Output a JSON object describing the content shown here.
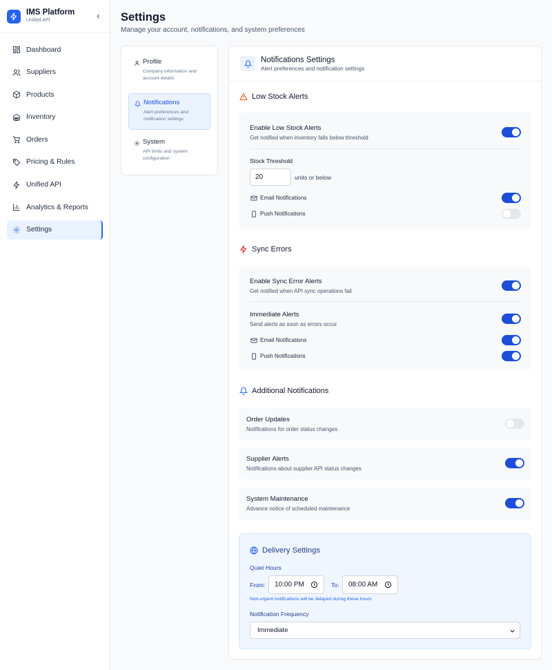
{
  "brand": {
    "title": "IMS Platform",
    "subtitle": "Unified API"
  },
  "sidebar": {
    "items": [
      {
        "label": "Dashboard",
        "icon": "dashboard-icon"
      },
      {
        "label": "Suppliers",
        "icon": "users-icon"
      },
      {
        "label": "Products",
        "icon": "package-icon"
      },
      {
        "label": "Inventory",
        "icon": "warehouse-icon"
      },
      {
        "label": "Orders",
        "icon": "cart-icon"
      },
      {
        "label": "Pricing & Rules",
        "icon": "tag-icon"
      },
      {
        "label": "Unified API",
        "icon": "bolt-icon"
      },
      {
        "label": "Analytics & Reports",
        "icon": "bar-chart-icon"
      },
      {
        "label": "Settings",
        "icon": "gear-icon",
        "active": true
      }
    ]
  },
  "header": {
    "title": "Settings",
    "subtitle": "Manage your account, notifications, and system preferences"
  },
  "subnav": {
    "items": [
      {
        "title": "Profile",
        "desc": "Company information and account details",
        "icon": "user-icon"
      },
      {
        "title": "Notifications",
        "desc": "Alert preferences and notification settings",
        "icon": "bell-icon",
        "active": true
      },
      {
        "title": "System",
        "desc": "API limits and system configuration",
        "icon": "gear-icon"
      }
    ]
  },
  "panel": {
    "title": "Notifications Settings",
    "subtitle": "Alert preferences and notification settings",
    "low_stock": {
      "section_title": "Low Stock Alerts",
      "enable_title": "Enable Low Stock Alerts",
      "enable_desc": "Get notified when inventory falls below threshold",
      "enable_on": true,
      "threshold_label": "Stock Threshold",
      "threshold_value": "20",
      "threshold_unit": "units or below",
      "email_label": "Email Notifications",
      "email_on": true,
      "push_label": "Push Notifications",
      "push_on": false
    },
    "sync_errors": {
      "section_title": "Sync Errors",
      "enable_title": "Enable Sync Error Alerts",
      "enable_desc": "Get notified when API sync operations fail",
      "enable_on": true,
      "immediate_title": "Immediate Alerts",
      "immediate_desc": "Send alerts as soon as errors occur",
      "immediate_on": true,
      "email_label": "Email Notifications",
      "email_on": true,
      "push_label": "Push Notifications",
      "push_on": true
    },
    "additional": {
      "section_title": "Additional Notifications",
      "items": [
        {
          "title": "Order Updates",
          "desc": "Notifications for order status changes",
          "on": false
        },
        {
          "title": "Supplier Alerts",
          "desc": "Notifications about supplier API status changes",
          "on": true
        },
        {
          "title": "System Maintenance",
          "desc": "Advance notice of scheduled maintenance",
          "on": true
        }
      ]
    },
    "delivery": {
      "title": "Delivery Settings",
      "quiet_hours_label": "Quiet Hours",
      "from_label": "From:",
      "from_value": "10:00 PM",
      "to_label": "To:",
      "to_value": "08:00 AM",
      "note": "Non-urgent notifications will be delayed during these hours",
      "frequency_label": "Notification Frequency",
      "frequency_value": "Immediate"
    }
  },
  "colors": {
    "accent": "#2563eb",
    "toggle_on": "#1d4ed8",
    "toggle_off": "#e5e7eb",
    "warning": "#ea580c",
    "error": "#dc2626"
  }
}
